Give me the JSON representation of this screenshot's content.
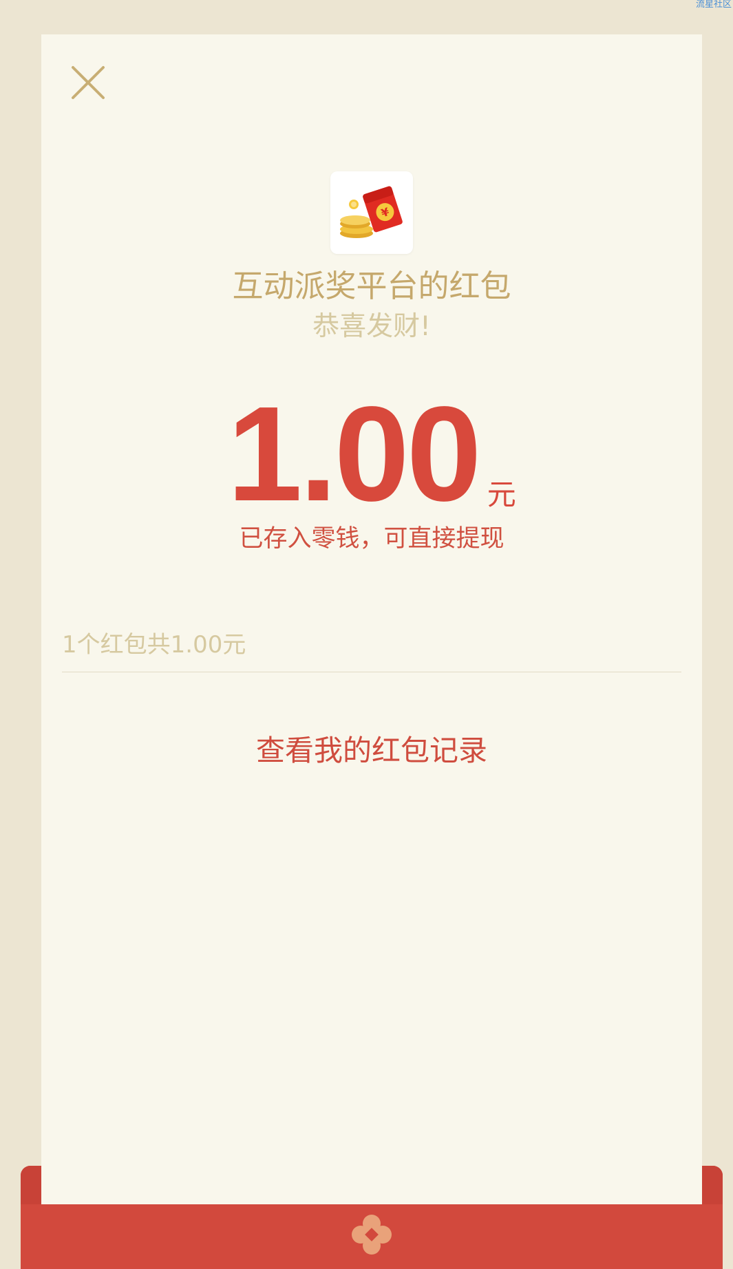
{
  "watermark": "流星社区",
  "packet": {
    "sender": "互动派奖平台的红包",
    "greeting": "恭喜发财!",
    "amount": "1.00",
    "unit": "元",
    "stored_note": "已存入零钱，可直接提现",
    "summary": "1个红包共1.00元",
    "records_link": "查看我的红包记录"
  },
  "icons": {
    "close": "close-icon",
    "logo": "red-envelope-coins-icon",
    "seal": "flower-seal-icon"
  },
  "colors": {
    "background": "#ECE5D2",
    "sheet": "#F9F7EC",
    "accent_red": "#D8493C",
    "gold_text": "#C5A86C",
    "muted_text": "#D6C9A0",
    "envelope_red": "#D2493D",
    "seal": "#E9A27A"
  }
}
